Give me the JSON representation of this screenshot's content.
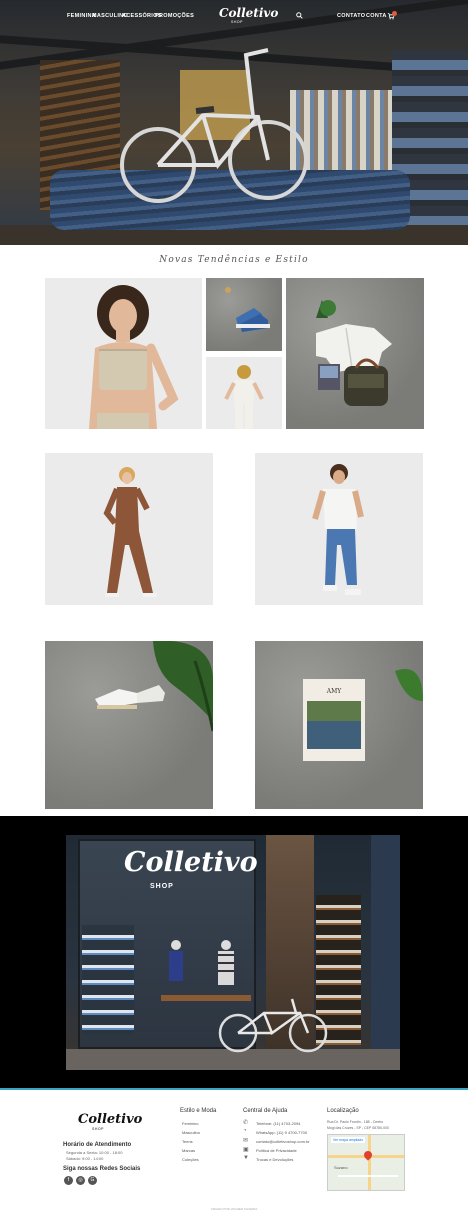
{
  "nav": {
    "left": [
      "FEMININA",
      "MASCULINO",
      "ACESSÓRIOS",
      "PROMOÇÕES"
    ],
    "brand": "Colletivo",
    "brand_sub": "SHOP",
    "right": [
      "CONTATO",
      "CONTA"
    ],
    "icons": [
      "search-icon",
      "cart-icon"
    ]
  },
  "section": {
    "title": "Novas Tendências e Estilo"
  },
  "store": {
    "sign": "Colletivo",
    "sign_sub": "SHOP"
  },
  "footer": {
    "brand": "Colletivo",
    "brand_sub": "SHOP",
    "hours_title": "Horário de Atendimento",
    "hours": [
      "Segunda a Sexta: 10:00 - 18:00",
      "Sábado: 9:00 - 14:00"
    ],
    "social_title": "Siga nossas Redes Sociais",
    "social_icons": [
      "facebook-icon",
      "instagram-icon",
      "google-icon"
    ],
    "col1_title": "Estilo e Moda",
    "col1_links": [
      "Feminino",
      "Masculino",
      "Teens",
      "Marcas",
      "Coleções"
    ],
    "col2_title": "Central de Ajuda",
    "col2_links": [
      "Telefone: (11) 4703-2094",
      "WhatsApp: (11) 9 4700-7700",
      "contato@colletivoshop.com.br",
      "Política de Privacidade",
      "Trocas e Devoluções"
    ],
    "col3_title": "Localização",
    "address": [
      "Rua Dr. Paulo Frontin - 188 - Centro",
      "Mogi das Cruzes - SP - CEP 08780-000"
    ],
    "map_label": "Ver mapa ampliado",
    "map_place": "Suzano",
    "credits": "CRIADO POR VAGNER SILVEIRA"
  }
}
